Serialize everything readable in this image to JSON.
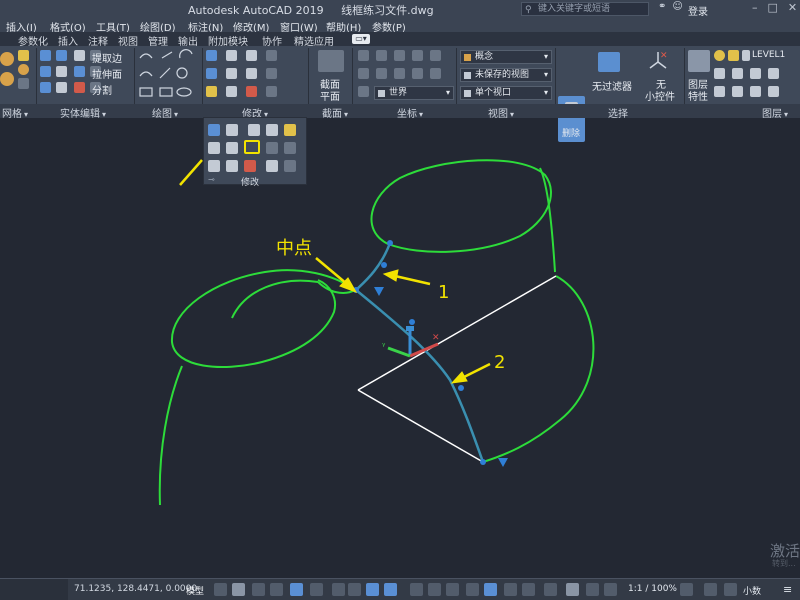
{
  "title": {
    "app": "Autodesk AutoCAD 2019",
    "file": "线框练习文件.dwg",
    "search_placeholder": "键入关键字或短语",
    "login": "登录"
  },
  "menu": [
    "插入(I)",
    "格式(O)",
    "工具(T)",
    "绘图(D)",
    "标注(N)",
    "修改(M)",
    "窗口(W)",
    "帮助(H)",
    "参数(P)"
  ],
  "tabs": [
    "参数化",
    "插入",
    "注释",
    "视图",
    "管理",
    "输出",
    "附加模块",
    "协作",
    "精选应用"
  ],
  "ribbon": {
    "solid_edit": {
      "extract_edges": "提取边",
      "extrude_faces": "拉伸面",
      "separate": "分割"
    },
    "section": {
      "label_top": "截面",
      "label_bottom": "平面"
    },
    "coords": {
      "world": "世界"
    },
    "view": {
      "visual_style": "概念",
      "unsaved_view": "未保存的视图",
      "single_viewport": "单个视口"
    },
    "selection": {
      "delete": "删除",
      "no_filter": "无过滤器",
      "no_gizmo_top": "无",
      "no_gizmo_bottom": "小控件"
    },
    "layers": {
      "layer_props_top": "图层",
      "layer_props_bottom": "特性",
      "layer_name": "LEVEL1"
    }
  },
  "panel_labels": [
    "网格",
    "实体编辑",
    "绘图",
    "修改",
    "截面",
    "坐标",
    "视图",
    "选择",
    "图层"
  ],
  "flyout_label": "修改",
  "annotations": {
    "midpoint": "中点",
    "one": "1",
    "two": "2"
  },
  "watermark": "激活",
  "watermark_sub": "转到...",
  "status": {
    "coords": "71.1235, 128.4471, 0.0000",
    "model": "模型",
    "scale": "1:1 / 100%",
    "units": "小数"
  },
  "colors": {
    "canvas": "#232833",
    "green_curve": "#2ddc3a",
    "blue_spline": "#3a8fb0",
    "grip": "#2f7fd6",
    "arrow": "#f2e300",
    "section_line": "#ffffff"
  }
}
